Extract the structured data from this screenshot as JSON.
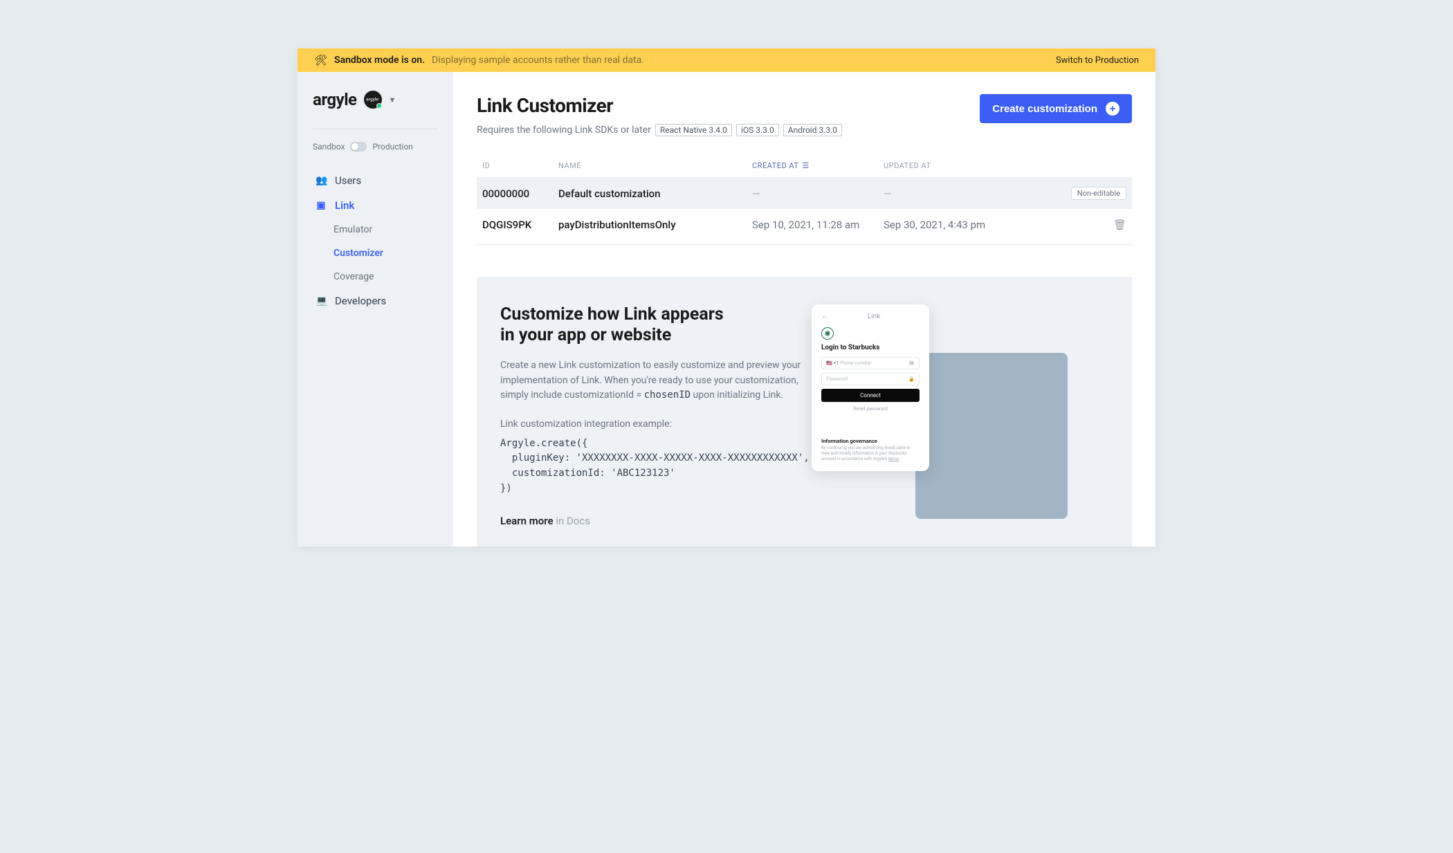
{
  "banner": {
    "bold": "Sandbox mode is on.",
    "light": "Displaying sample accounts rather than real data.",
    "switch": "Switch to Production"
  },
  "sidebar": {
    "brand": "argyle",
    "orgAbbrev": "argyle",
    "env": {
      "left": "Sandbox",
      "right": "Production"
    },
    "nav": {
      "users": "Users",
      "link": "Link",
      "emulator": "Emulator",
      "customizer": "Customizer",
      "coverage": "Coverage",
      "developers": "Developers"
    }
  },
  "page": {
    "title": "Link Customizer",
    "subline": "Requires the following Link SDKs or later",
    "sdks": [
      "React Native 3.4.0",
      "iOS 3.3.0",
      "Android 3.3.0"
    ],
    "createBtn": "Create customization"
  },
  "table": {
    "headers": {
      "id": "ID",
      "name": "NAME",
      "created": "CREATED AT",
      "updated": "UPDATED AT"
    },
    "rows": [
      {
        "id": "00000000",
        "name": "Default customization",
        "created": "—",
        "updated": "—",
        "badge": "Non-editable",
        "trash": false
      },
      {
        "id": "DQGIS9PK",
        "name": "payDistributionItemsOnly",
        "created": "Sep 10, 2021, 11:28 am",
        "updated": "Sep 30, 2021, 4:43 pm",
        "badge": null,
        "trash": true
      }
    ]
  },
  "explainer": {
    "h1a": "Customize how Link appears",
    "h1b": "in your app or website",
    "p1": "Create a new Link customization to easily customize and preview your implementation of Link. When you're ready to use your customization, simply include customizationId = ",
    "chosen": "chosenID",
    "p1tail": " upon initializing Link.",
    "exampleLabel": "Link customization integration example:",
    "code": "Argyle.create({\n  pluginKey: 'XXXXXXXX-XXXX-XXXXX-XXXX-XXXXXXXXXXXX',\n  customizationId: 'ABC123123'\n})",
    "learnMore": "Learn more",
    "inDocs": " in Docs"
  },
  "phone": {
    "topCenter": "Link",
    "loginTitle": "Login to Starbucks",
    "flagPrefix": "🇺🇸 +1",
    "phPhone": "Phone number",
    "phPassword": "Password",
    "connect": "Connect",
    "reset": "Reset password",
    "infoTitle": "Information governance",
    "infoBody": "By continuing, you are authorizing GoodLoans to view and modify information in your Starbucks account in accordance with Argyle's ",
    "terms": "terms"
  }
}
